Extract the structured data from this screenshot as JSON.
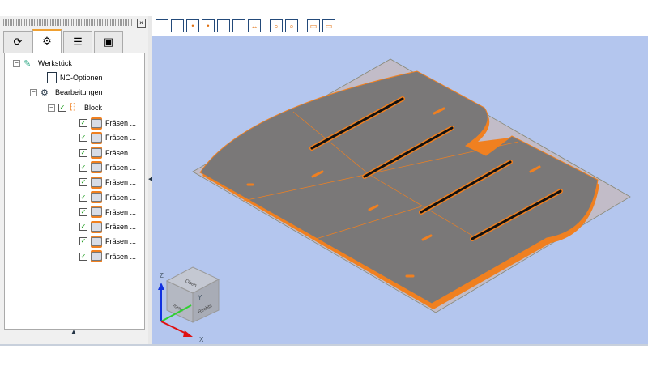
{
  "panel": {
    "close_icon": "×",
    "tabs": [
      "geometry-icon",
      "machining-icon",
      "list-icon",
      "tool-icon"
    ],
    "active_tab": 1
  },
  "tree": {
    "root": "Werkstück",
    "nc": "NC-Optionen",
    "machining": "Bearbeitungen",
    "block": "Block",
    "items": [
      "Fräsen ...",
      "Fräsen ...",
      "Fräsen ...",
      "Fräsen ...",
      "Fräsen ...",
      "Fräsen ...",
      "Fräsen ...",
      "Fräsen ...",
      "Fräsen ...",
      "Fräsen ..."
    ]
  },
  "toolbar": [
    "view-iso",
    "view-back",
    "view-front",
    "view-top",
    "view-left",
    "view-right",
    "view-dimensions",
    "zoom",
    "zoom-fit",
    "layout-1",
    "layout-2"
  ],
  "viewcube": {
    "top": "Oben",
    "front": "Vorne",
    "right": "Rechts"
  },
  "axes": {
    "x": "X",
    "y": "Y",
    "z": "Z"
  },
  "colors": {
    "viewport": "#b4c6ee",
    "part": "#f08020",
    "accent": "#f0a030"
  }
}
